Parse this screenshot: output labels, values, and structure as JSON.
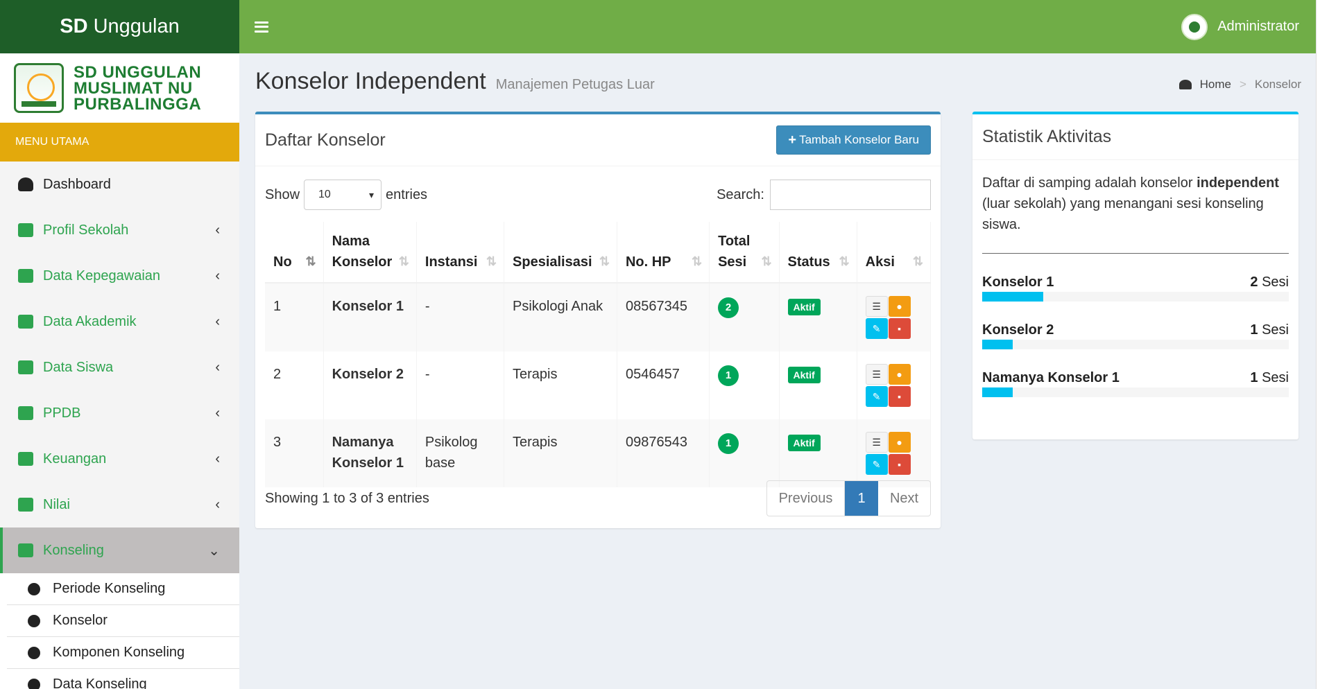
{
  "app": {
    "brand_bold": "SD",
    "brand_rest": "Unggulan",
    "user": "Administrator"
  },
  "sidebar": {
    "logo_text": [
      "SD UNGGULAN",
      "MUSLIMAT NU",
      "PURBALINGGA"
    ],
    "menu_header": "MENU UTAMA",
    "items": [
      {
        "label": "Dashboard",
        "icon": "dashboard-icon"
      },
      {
        "label": "Profil Sekolah",
        "icon": "building-icon"
      },
      {
        "label": "Data Kepegawaian",
        "icon": "briefcase-icon"
      },
      {
        "label": "Data Akademik",
        "icon": "book-icon"
      },
      {
        "label": "Data Siswa",
        "icon": "graduation-cap-icon"
      },
      {
        "label": "PPDB",
        "icon": "note-icon"
      },
      {
        "label": "Keuangan",
        "icon": "money-icon"
      },
      {
        "label": "Nilai",
        "icon": "calculator-icon"
      },
      {
        "label": "Konseling",
        "icon": "heartbeat-icon"
      }
    ],
    "sub_items": [
      "Periode Konseling",
      "Konselor",
      "Komponen Konseling",
      "Data Konseling"
    ]
  },
  "header": {
    "title": "Konselor Independent",
    "subtitle": "Manajemen Petugas Luar"
  },
  "breadcrumb": {
    "home": "Home",
    "separator": ">",
    "current": "Konselor"
  },
  "main": {
    "title": "Daftar Konselor",
    "add_button": "Tambah Konselor Baru",
    "show_label": "Show",
    "entries_label": "entries",
    "page_size": "10",
    "search_label": "Search:",
    "columns": [
      "No",
      "Nama Konselor",
      "Instansi",
      "Spesialisasi",
      "No. HP",
      "Total Sesi",
      "Status",
      "Aksi"
    ],
    "rows": [
      {
        "no": "1",
        "nama": "Konselor 1",
        "instansi": "-",
        "spesialisasi": "Psikologi Anak",
        "hp": "08567345",
        "sesi": "2",
        "status": "Aktif"
      },
      {
        "no": "2",
        "nama": "Konselor 2",
        "instansi": "-",
        "spesialisasi": "Terapis",
        "hp": "0546457",
        "sesi": "1",
        "status": "Aktif"
      },
      {
        "no": "3",
        "nama": "Namanya Konselor 1",
        "instansi": "Psikolog base",
        "spesialisasi": "Terapis",
        "hp": "09876543",
        "sesi": "1",
        "status": "Aktif"
      }
    ],
    "info": "Showing 1 to 3 of 3 entries",
    "pager": {
      "prev": "Previous",
      "current": "1",
      "next": "Next"
    }
  },
  "side": {
    "title": "Statistik Aktivitas",
    "desc_before": "Daftar di samping adalah konselor ",
    "desc_bold": "independent",
    "desc_after": " (luar sekolah) yang menangani sesi konseling siswa.",
    "unit": "Sesi",
    "stats": [
      {
        "name": "Konselor 1",
        "count": "2",
        "fraction": 0.2
      },
      {
        "name": "Konselor 2",
        "count": "1",
        "fraction": 0.1
      },
      {
        "name": "Namanya Konselor 1",
        "count": "1",
        "fraction": 0.1
      }
    ]
  },
  "colors": {
    "brand_dark": "#1e5e28",
    "navbar": "#70ad47",
    "menu_header": "#e3a90c",
    "primary": "#3c8dbc",
    "success": "#00a65a",
    "info": "#00c0ef"
  }
}
